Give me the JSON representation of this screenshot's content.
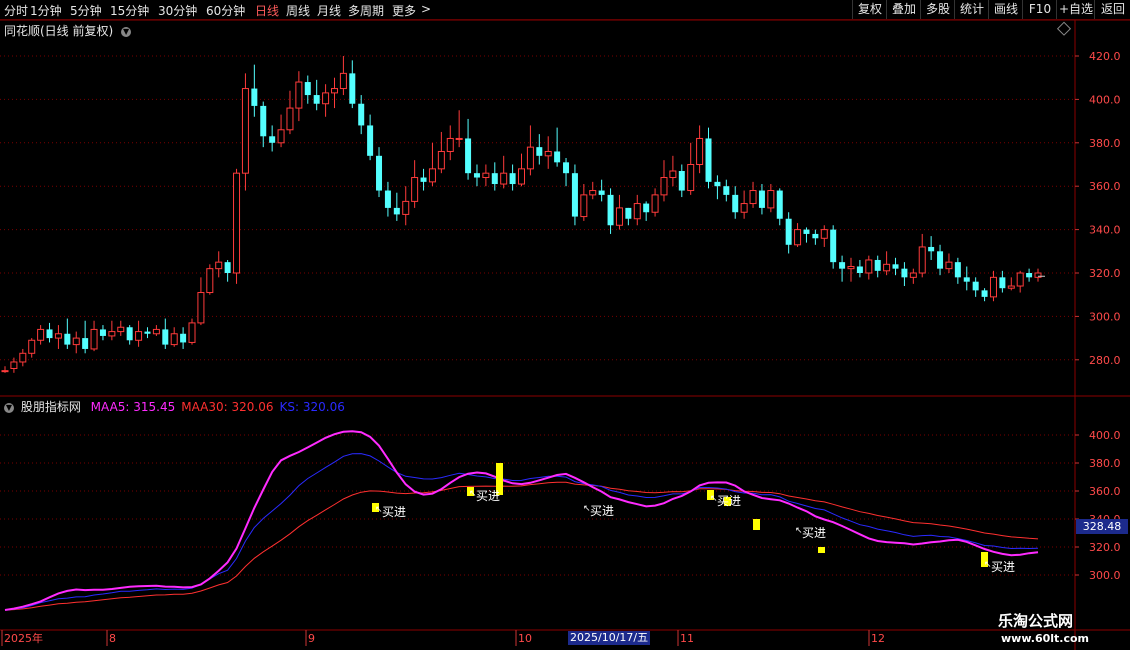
{
  "toolbar": {
    "periods": [
      {
        "label": "分时",
        "x": 4,
        "active": false
      },
      {
        "label": "1分钟",
        "x": 30,
        "active": false
      },
      {
        "label": "5分钟",
        "x": 70,
        "active": false
      },
      {
        "label": "15分钟",
        "x": 110,
        "active": false
      },
      {
        "label": "30分钟",
        "x": 158,
        "active": false
      },
      {
        "label": "60分钟",
        "x": 206,
        "active": false
      },
      {
        "label": "日线",
        "x": 255,
        "active": true
      },
      {
        "label": "周线",
        "x": 286,
        "active": false
      },
      {
        "label": "月线",
        "x": 317,
        "active": false
      },
      {
        "label": "多周期",
        "x": 348,
        "active": false
      },
      {
        "label": "更多",
        "x": 392,
        "active": false
      }
    ],
    "more_arrow": ">",
    "actions": [
      "复权",
      "叠加",
      "多股",
      "统计",
      "画线",
      "F10",
      "+自选",
      "返回"
    ]
  },
  "main_panel": {
    "title": "同花顺(日线 前复权)",
    "y_ticks": [
      "420.0",
      "400.0",
      "380.0",
      "360.0",
      "340.0",
      "320.0",
      "300.0",
      "280.0"
    ]
  },
  "indicator_panel": {
    "name": "股朋指标网",
    "legend": [
      {
        "label": "MAA5: 315.45",
        "color": "#ff2bff"
      },
      {
        "label": "MAA30: 320.06",
        "color": "#ff3030"
      },
      {
        "label": "KS: 320.06",
        "color": "#2a2aff"
      }
    ],
    "y_ticks": [
      "400.0",
      "380.0",
      "360.0",
      "340.0",
      "320.0",
      "300.0"
    ],
    "current_value": "328.48",
    "signal_label": "买进",
    "signals": [
      {
        "x": 376,
        "y": 512
      },
      {
        "x": 470,
        "y": 496
      },
      {
        "x": 584,
        "y": 511
      },
      {
        "x": 711,
        "y": 501
      },
      {
        "x": 796,
        "y": 533
      },
      {
        "x": 985,
        "y": 567
      }
    ]
  },
  "x_axis": {
    "labels": [
      {
        "text": "2025年",
        "x": 4
      },
      {
        "text": "8",
        "x": 109
      },
      {
        "text": "9",
        "x": 308
      },
      {
        "text": "10",
        "x": 518
      },
      {
        "text": "11",
        "x": 680
      },
      {
        "text": "12",
        "x": 871
      }
    ],
    "cursor_date": "2025/10/17/五"
  },
  "watermark": {
    "line1": "乐淘公式网",
    "line2": "www.60lt.com"
  },
  "colors": {
    "up": "#ff3b3b",
    "down": "#54ffff",
    "maa5": "#ff2bff",
    "maa30": "#ff3030",
    "ks": "#2a2aff",
    "signal": "#ffff00",
    "axis": "#8b0000"
  },
  "chart_data": {
    "type": "candlestick",
    "title": "同花顺(日线 前复权)",
    "ylim": [
      270,
      425
    ],
    "candles": [
      [
        275,
        275,
        277,
        274
      ],
      [
        276,
        279,
        281,
        274
      ],
      [
        279,
        283,
        285,
        277
      ],
      [
        283,
        289,
        290,
        281
      ],
      [
        289,
        294,
        296,
        287
      ],
      [
        294,
        290,
        297,
        288
      ],
      [
        290,
        292,
        296,
        285
      ],
      [
        292,
        287,
        299,
        285
      ],
      [
        287,
        290,
        293,
        283
      ],
      [
        290,
        285,
        298,
        283
      ],
      [
        285,
        294,
        298,
        284
      ],
      [
        294,
        291,
        296,
        289
      ],
      [
        291,
        293,
        298,
        289
      ],
      [
        293,
        295,
        298,
        291
      ],
      [
        295,
        289,
        296,
        287
      ],
      [
        289,
        293,
        298,
        286
      ],
      [
        293,
        292,
        295,
        290
      ],
      [
        292,
        294,
        296,
        291
      ],
      [
        294,
        287,
        299,
        285
      ],
      [
        287,
        292,
        295,
        286
      ],
      [
        292,
        288,
        295,
        285
      ],
      [
        288,
        297,
        299,
        287
      ],
      [
        297,
        311,
        318,
        296
      ],
      [
        311,
        322,
        324,
        310
      ],
      [
        322,
        325,
        330,
        318
      ],
      [
        325,
        320,
        326,
        316
      ],
      [
        320,
        366,
        368,
        315
      ],
      [
        366,
        405,
        412,
        358
      ],
      [
        405,
        397,
        416,
        392
      ],
      [
        397,
        383,
        399,
        378
      ],
      [
        383,
        380,
        388,
        376
      ],
      [
        380,
        386,
        393,
        378
      ],
      [
        386,
        396,
        404,
        384
      ],
      [
        396,
        408,
        413,
        390
      ],
      [
        408,
        402,
        411,
        398
      ],
      [
        402,
        398,
        409,
        395
      ],
      [
        398,
        403,
        407,
        392
      ],
      [
        403,
        405,
        410,
        396
      ],
      [
        405,
        412,
        420,
        402
      ],
      [
        412,
        398,
        418,
        396
      ],
      [
        398,
        388,
        402,
        384
      ],
      [
        388,
        374,
        393,
        372
      ],
      [
        374,
        358,
        378,
        355
      ],
      [
        358,
        350,
        362,
        346
      ],
      [
        350,
        347,
        357,
        344
      ],
      [
        347,
        353,
        360,
        342
      ],
      [
        353,
        364,
        372,
        350
      ],
      [
        364,
        362,
        368,
        358
      ],
      [
        362,
        368,
        380,
        360
      ],
      [
        368,
        376,
        385,
        366
      ],
      [
        376,
        382,
        388,
        372
      ],
      [
        382,
        382,
        395,
        378
      ],
      [
        382,
        366,
        391,
        363
      ],
      [
        366,
        364,
        370,
        360
      ],
      [
        364,
        366,
        370,
        360
      ],
      [
        366,
        361,
        371,
        358
      ],
      [
        361,
        366,
        374,
        359
      ],
      [
        366,
        361,
        370,
        358
      ],
      [
        361,
        368,
        375,
        360
      ],
      [
        368,
        378,
        388,
        365
      ],
      [
        378,
        374,
        384,
        370
      ],
      [
        374,
        376,
        383,
        368
      ],
      [
        376,
        371,
        387,
        369
      ],
      [
        371,
        366,
        373,
        360
      ],
      [
        366,
        346,
        370,
        342
      ],
      [
        346,
        356,
        361,
        344
      ],
      [
        356,
        358,
        362,
        354
      ],
      [
        358,
        356,
        363,
        353
      ],
      [
        356,
        342,
        359,
        338
      ],
      [
        342,
        350,
        356,
        340
      ],
      [
        350,
        345,
        350,
        342
      ],
      [
        345,
        352,
        356,
        342
      ],
      [
        352,
        348,
        353,
        344
      ],
      [
        348,
        356,
        359,
        346
      ],
      [
        356,
        364,
        372,
        353
      ],
      [
        364,
        367,
        374,
        360
      ],
      [
        367,
        358,
        370,
        355
      ],
      [
        358,
        370,
        380,
        356
      ],
      [
        370,
        382,
        388,
        366
      ],
      [
        382,
        362,
        387,
        359
      ],
      [
        362,
        360,
        365,
        354
      ],
      [
        360,
        356,
        363,
        353
      ],
      [
        356,
        348,
        360,
        345
      ],
      [
        348,
        352,
        358,
        345
      ],
      [
        352,
        358,
        362,
        350
      ],
      [
        358,
        350,
        361,
        347
      ],
      [
        350,
        358,
        361,
        348
      ],
      [
        358,
        345,
        359,
        342
      ],
      [
        345,
        333,
        348,
        329
      ],
      [
        333,
        340,
        343,
        332
      ],
      [
        340,
        338,
        341,
        334
      ],
      [
        338,
        336,
        340,
        333
      ],
      [
        336,
        340,
        342,
        332
      ],
      [
        340,
        325,
        342,
        322
      ],
      [
        325,
        322,
        328,
        316
      ],
      [
        322,
        323,
        327,
        316
      ],
      [
        323,
        320,
        326,
        318
      ],
      [
        320,
        326,
        328,
        317
      ],
      [
        326,
        321,
        328,
        318
      ],
      [
        321,
        324,
        330,
        319
      ],
      [
        324,
        322,
        327,
        319
      ],
      [
        322,
        318,
        325,
        314
      ],
      [
        318,
        320,
        322,
        315
      ],
      [
        320,
        332,
        338,
        318
      ],
      [
        332,
        330,
        337,
        326
      ],
      [
        330,
        322,
        333,
        319
      ],
      [
        322,
        325,
        329,
        320
      ],
      [
        325,
        318,
        327,
        315
      ],
      [
        318,
        316,
        323,
        312
      ],
      [
        316,
        312,
        318,
        309
      ],
      [
        312,
        309,
        313,
        307
      ],
      [
        309,
        318,
        321,
        307
      ],
      [
        318,
        313,
        321,
        311
      ],
      [
        313,
        314,
        318,
        312
      ],
      [
        314,
        320,
        321,
        311
      ],
      [
        320,
        318,
        322,
        316
      ],
      [
        318,
        320,
        322,
        316
      ]
    ]
  }
}
